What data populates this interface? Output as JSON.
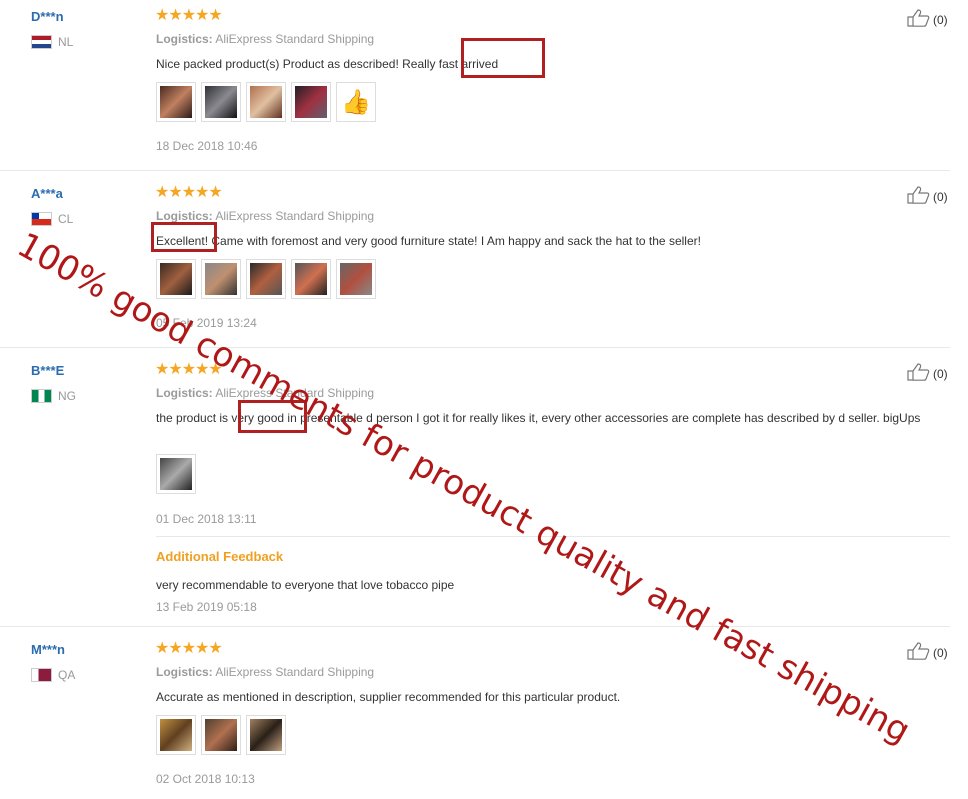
{
  "reviews": [
    {
      "user": "D***n",
      "country": "NL",
      "stars": "★★★★★",
      "logistics_label": "Logistics:",
      "logistics_value": "AliExpress Standard Shipping",
      "text": "Nice packed product(s) Product as described! Really fast arrived",
      "photos": 5,
      "date": "18 Dec 2018 10:46",
      "helpful": "(0)"
    },
    {
      "user": "A***a",
      "country": "CL",
      "stars": "★★★★★",
      "logistics_label": "Logistics:",
      "logistics_value": "AliExpress Standard Shipping",
      "text": "Excellent! Came with foremost and very good furniture state! I Am happy and sack the hat to the seller!",
      "photos": 5,
      "date": "05 Feb 2019 13:24",
      "helpful": "(0)"
    },
    {
      "user": "B***E",
      "country": "NG",
      "stars": "★★★★★",
      "logistics_label": "Logistics:",
      "logistics_value": "AliExpress Standard Shipping",
      "text": "the product is very good in presentable d person I got it for really likes it, every other accessories are complete has described by d seller. bigUps",
      "photos": 1,
      "date": "01 Dec 2018 13:11",
      "helpful": "(0)",
      "additional_label": "Additional Feedback",
      "additional_text": "very recommendable to everyone that love tobacco pipe",
      "additional_date": "13 Feb 2019 05:18"
    },
    {
      "user": "M***n",
      "country": "QA",
      "stars": "★★★★★",
      "logistics_label": "Logistics:",
      "logistics_value": "AliExpress Standard Shipping",
      "text": "Accurate as mentioned in description, supplier recommended for this particular product.",
      "photos": 3,
      "date": "02 Oct 2018 10:13",
      "helpful": "(0)"
    }
  ],
  "watermark": "100% good comments for product quality and fast shipping",
  "colors": {
    "accent_blue": "#2b6cb0",
    "star_orange": "#f5a623",
    "highlight_red": "#b02020",
    "additional_orange": "#f0a020"
  },
  "icons": {
    "helpful": "thumbs-up-icon",
    "rating": "star-icon"
  }
}
